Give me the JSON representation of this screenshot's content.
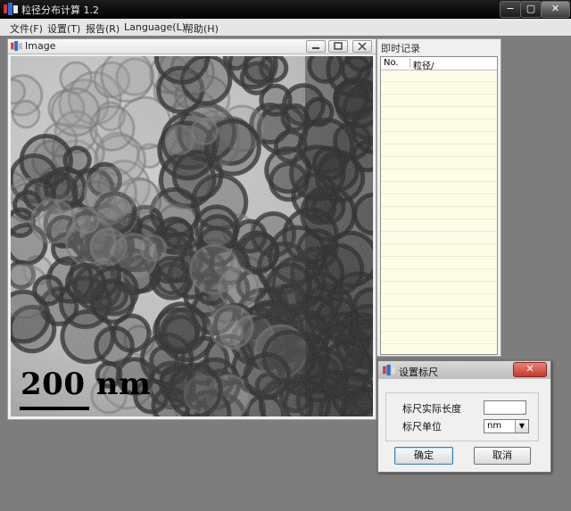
{
  "app": {
    "title": "粒径分布计算 1.2",
    "icon": "app-icon"
  },
  "window_controls": {
    "minimize": "−",
    "maximize": "▢",
    "close": "✕"
  },
  "menu": [
    {
      "label": "文件(F)"
    },
    {
      "label": "设置(T)"
    },
    {
      "label": "报告(R)"
    },
    {
      "label": "Language(L)"
    },
    {
      "label": "帮助(H)"
    }
  ],
  "image_window": {
    "title": "Image",
    "scale_text": "200 nm"
  },
  "record_window": {
    "title": "即时记录",
    "columns": [
      "No.",
      "粒径/"
    ]
  },
  "dialog": {
    "title": "设置标尺",
    "close": "✕",
    "length_label": "标尺实际长度",
    "length_value": "",
    "unit_label": "标尺单位",
    "unit_value": "nm",
    "ok": "确定",
    "cancel": "取消"
  }
}
